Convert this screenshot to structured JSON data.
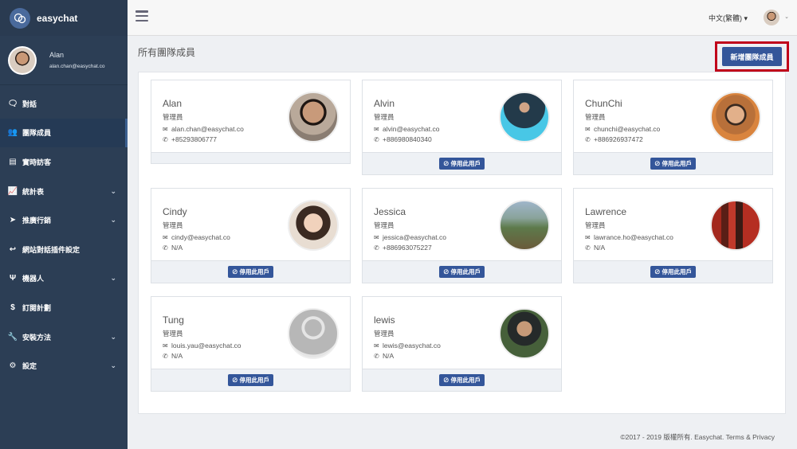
{
  "brand": {
    "name": "easychat"
  },
  "user": {
    "name": "Alan",
    "email": "alan.chan@easychat.co"
  },
  "nav": [
    {
      "label": "對話",
      "icon": "chat-icon",
      "glyph": "🗨",
      "chevron": false
    },
    {
      "label": "團隊成員",
      "icon": "users-icon",
      "glyph": "👥",
      "chevron": false,
      "active": true
    },
    {
      "label": "實時訪客",
      "icon": "id-card-icon",
      "glyph": "▤",
      "chevron": false
    },
    {
      "label": "統計表",
      "icon": "chart-icon",
      "glyph": "📈",
      "chevron": true
    },
    {
      "label": "推廣行銷",
      "icon": "paper-plane-icon",
      "glyph": "➤",
      "chevron": true
    },
    {
      "label": "網站對話插件設定",
      "icon": "reply-all-icon",
      "glyph": "↩",
      "chevron": false
    },
    {
      "label": "機器人",
      "icon": "fork-icon",
      "glyph": "Ψ",
      "chevron": true
    },
    {
      "label": "訂閱計劃",
      "icon": "dollar-icon",
      "glyph": "$",
      "chevron": false
    },
    {
      "label": "安裝方法",
      "icon": "wrench-icon",
      "glyph": "🔧",
      "chevron": true
    },
    {
      "label": "設定",
      "icon": "gear-icon",
      "glyph": "⚙",
      "chevron": true
    }
  ],
  "topbar": {
    "language": "中文(繁體)"
  },
  "page": {
    "title": "所有團隊成員",
    "add_button": "新增團隊成員"
  },
  "members": [
    {
      "name": "Alan",
      "role": "管理員",
      "email": "alan.chan@easychat.co",
      "phone": "+85293806777",
      "disable_label": "",
      "photo": "portrait"
    },
    {
      "name": "Alvin",
      "role": "管理員",
      "email": "alvin@easychat.co",
      "phone": "+886980840340",
      "disable_label": "⊘ 停用此用戶",
      "photo": "blue"
    },
    {
      "name": "ChunChi",
      "role": "管理員",
      "email": "chunchi@easychat.co",
      "phone": "+886926937472",
      "disable_label": "⊘ 停用此用戶",
      "photo": "warm"
    },
    {
      "name": "Cindy",
      "role": "管理員",
      "email": "cindy@easychat.co",
      "phone": "N/A",
      "disable_label": "⊘ 停用此用戶",
      "photo": "portrait-light"
    },
    {
      "name": "Jessica",
      "role": "管理員",
      "email": "jessica@easychat.co",
      "phone": "+886963075227",
      "disable_label": "⊘ 停用此用戶",
      "photo": "landscape"
    },
    {
      "name": "Lawrence",
      "role": "管理員",
      "email": "lawrance.ho@easychat.co",
      "phone": "N/A",
      "disable_label": "⊘ 停用此用戶",
      "photo": "red-gates"
    },
    {
      "name": "Tung",
      "role": "管理員",
      "email": "louis.yau@easychat.co",
      "phone": "N/A",
      "disable_label": "⊘ 停用此用戶",
      "photo": "placeholder"
    },
    {
      "name": "lewis",
      "role": "管理員",
      "email": "lewis@easychat.co",
      "phone": "N/A",
      "disable_label": "⊘ 停用此用戶",
      "photo": "outdoor"
    }
  ],
  "footer": {
    "text": "©2017 - 2019 版權所有. Easychat. Terms & Privacy"
  }
}
